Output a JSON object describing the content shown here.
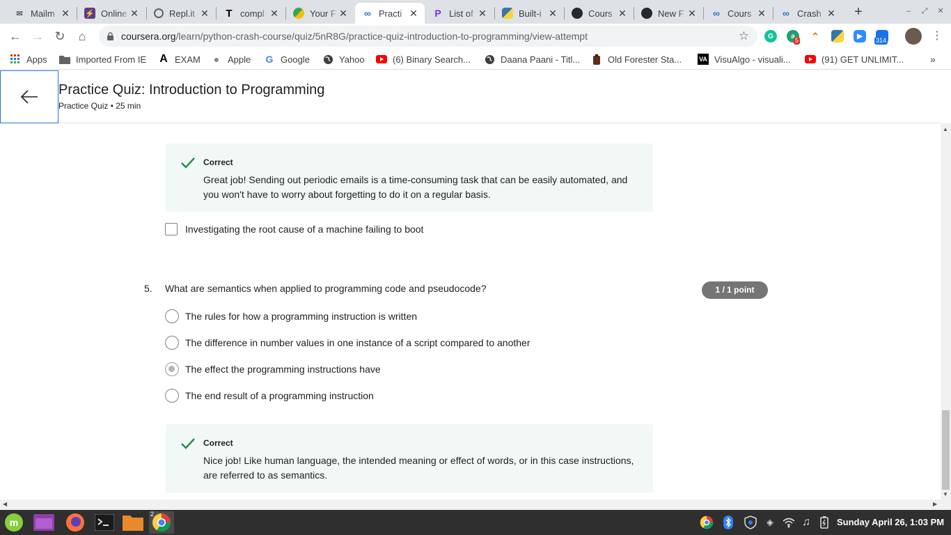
{
  "browser": {
    "tabs": [
      {
        "title": "Mailm",
        "favicon": "mail-icon"
      },
      {
        "title": "Online",
        "favicon": "bolt-icon"
      },
      {
        "title": "Repl.it",
        "favicon": "replit-icon"
      },
      {
        "title": "compl",
        "favicon": "t-icon"
      },
      {
        "title": "Your F",
        "favicon": "circle-icon"
      },
      {
        "title": "Practi",
        "favicon": "coursera-icon",
        "active": true
      },
      {
        "title": "List of",
        "favicon": "p-icon"
      },
      {
        "title": "Built-i",
        "favicon": "python-icon"
      },
      {
        "title": "Cours",
        "favicon": "github-icon"
      },
      {
        "title": "New F",
        "favicon": "github-icon"
      },
      {
        "title": "Cours",
        "favicon": "coursera-icon"
      },
      {
        "title": "Crash",
        "favicon": "coursera-icon"
      }
    ],
    "url": {
      "host": "coursera.org",
      "path": "/learn/python-crash-course/quiz/5nR8G/practice-quiz-introduction-to-programming/view-attempt"
    },
    "extensions": {
      "badge_a": "5",
      "badge_zoom": "314"
    },
    "bookmarks": [
      {
        "label": "Apps",
        "icon": "apps-grid-icon"
      },
      {
        "label": "Imported From IE",
        "icon": "folder-icon"
      },
      {
        "label": "EXAM",
        "icon": "a-logo-icon"
      },
      {
        "label": "Apple",
        "icon": "apple-icon"
      },
      {
        "label": "Google",
        "icon": "google-icon"
      },
      {
        "label": "Yahoo",
        "icon": "globe-icon"
      },
      {
        "label": "(6) Binary Search...",
        "icon": "youtube-icon"
      },
      {
        "label": "Daana Paani - Titl...",
        "icon": "globe-icon"
      },
      {
        "label": "Old Forester Sta...",
        "icon": "bottle-icon"
      },
      {
        "label": "VisuAlgo - visuali...",
        "icon": "visualgo-icon"
      },
      {
        "label": "(91) GET UNLIMIT...",
        "icon": "youtube-icon"
      }
    ]
  },
  "quiz": {
    "title": "Practice Quiz: Introduction to Programming",
    "subtitle": "Practice Quiz • 25 min"
  },
  "q4": {
    "feedback_label": "Correct",
    "feedback_text": "Great job! Sending out periodic emails is a time-consuming task that can be easily automated, and you won't have to worry about forgetting to do it on a regular basis.",
    "option_after": "Investigating the root cause of a machine failing to boot"
  },
  "q5": {
    "number": "5.",
    "question": "What are semantics when applied to programming code and pseudocode?",
    "points": "1 / 1 point",
    "options": [
      {
        "label": "The rules for how a programming instruction is written",
        "selected": false
      },
      {
        "label": "The difference in number values in one instance of a script compared to another",
        "selected": false
      },
      {
        "label": "The effect the programming instructions have",
        "selected": true
      },
      {
        "label": "The end result of a programming instruction",
        "selected": false
      }
    ],
    "feedback_label": "Correct",
    "feedback_text": "Nice job! Like human language, the intended meaning or effect of words, or in this case instructions, are referred to as semantics."
  },
  "taskbar": {
    "chrome_windows": "2",
    "clock": "Sunday April 26,  1:03 PM"
  },
  "colors": {
    "correct_green": "#1e8f4e",
    "feedback_bg": "#f1f8f5",
    "points_badge": "#757575",
    "focus_blue": "#2a73cc"
  }
}
